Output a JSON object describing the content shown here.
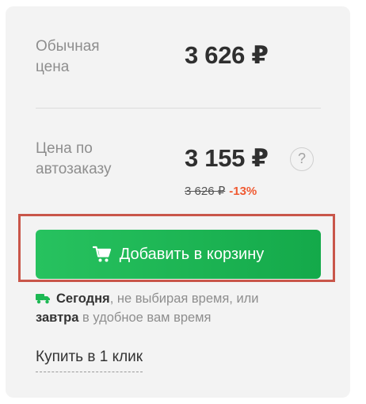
{
  "regular": {
    "label": "Обычная цена",
    "price": "3 626 ₽"
  },
  "autoorder": {
    "label": "Цена по автозаказу",
    "price": "3 155 ₽",
    "old_price": "3 626 ₽",
    "discount": "-13%",
    "help_label": "?"
  },
  "cart_button": {
    "label": "Добавить в корзину"
  },
  "delivery": {
    "today": "Сегодня",
    "today_text": ", не выбирая время, или",
    "tomorrow": "завтра",
    "tomorrow_text": " в удобное вам время"
  },
  "buy_one_click": {
    "label": "Купить в 1 клик"
  },
  "colors": {
    "accent_green": "#1db954",
    "discount_red": "#f05a32",
    "highlight_border": "#c9564a"
  },
  "icons": {
    "cart": "cart-icon",
    "truck": "truck-icon",
    "help": "help-icon"
  }
}
